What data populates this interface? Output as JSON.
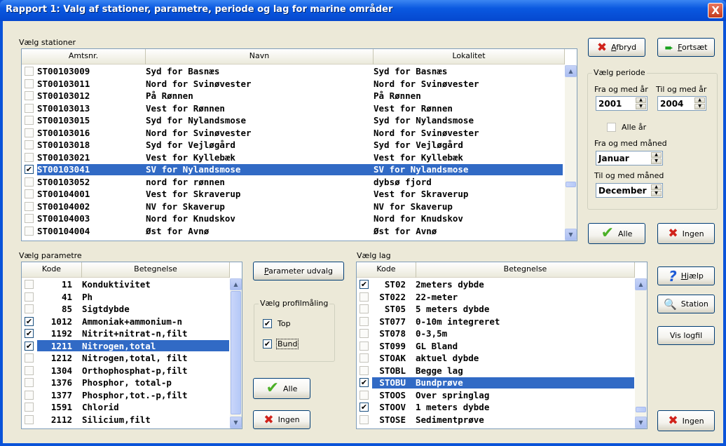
{
  "window": {
    "title": "Rapport 1: Valg af stationer, parametre, periode og lag for marine områder",
    "close_glyph": "X"
  },
  "stations": {
    "group_label": "Vælg stationer",
    "columns": [
      "Amtsnr.",
      "Navn",
      "Lokalitet"
    ],
    "rows": [
      {
        "checked": false,
        "selected": false,
        "amtsnr": "ST00103009",
        "navn": "Syd for Basnæs",
        "lokalitet": "Syd for Basnæs"
      },
      {
        "checked": false,
        "selected": false,
        "amtsnr": "ST00103011",
        "navn": "Nord for Svinøvester",
        "lokalitet": "Nord for Svinøvester"
      },
      {
        "checked": false,
        "selected": false,
        "amtsnr": "ST00103012",
        "navn": "På Rønnen",
        "lokalitet": "På Rønnen"
      },
      {
        "checked": false,
        "selected": false,
        "amtsnr": "ST00103013",
        "navn": "Vest for Rønnen",
        "lokalitet": "Vest for Rønnen"
      },
      {
        "checked": false,
        "selected": false,
        "amtsnr": "ST00103015",
        "navn": "Syd for Nylandsmose",
        "lokalitet": "Syd for Nylandsmose"
      },
      {
        "checked": false,
        "selected": false,
        "amtsnr": "ST00103016",
        "navn": "Nord for Svinøvester",
        "lokalitet": "Nord for Svinøvester"
      },
      {
        "checked": false,
        "selected": false,
        "amtsnr": "ST00103018",
        "navn": "Syd for Vejløgård",
        "lokalitet": "Syd for Vejløgård"
      },
      {
        "checked": false,
        "selected": false,
        "amtsnr": "ST00103021",
        "navn": "Vest for Kyllebæk",
        "lokalitet": "Vest for Kyllebæk"
      },
      {
        "checked": true,
        "selected": true,
        "amtsnr": "ST00103041",
        "navn": "SV for Nylandsmose",
        "lokalitet": "SV for Nylandsmose"
      },
      {
        "checked": false,
        "selected": false,
        "amtsnr": "ST00103052",
        "navn": "nord for rønnen",
        "lokalitet": "dybsø fjord"
      },
      {
        "checked": false,
        "selected": false,
        "amtsnr": "ST00104001",
        "navn": "Vest for Skraverup",
        "lokalitet": "Vest for Skraverup"
      },
      {
        "checked": false,
        "selected": false,
        "amtsnr": "ST00104002",
        "navn": "NV for Skaverup",
        "lokalitet": "NV for Skaverup"
      },
      {
        "checked": false,
        "selected": false,
        "amtsnr": "ST00104003",
        "navn": "Nord for Knudskov",
        "lokalitet": "Nord for Knudskov"
      },
      {
        "checked": false,
        "selected": false,
        "amtsnr": "ST00104004",
        "navn": "Øst for Avnø",
        "lokalitet": "Øst for Avnø"
      }
    ]
  },
  "parameters": {
    "group_label": "Vælg parametre",
    "columns": [
      "Kode",
      "Betegnelse"
    ],
    "rows": [
      {
        "checked": false,
        "selected": false,
        "kode": "11",
        "betegnelse": "Konduktivitet"
      },
      {
        "checked": false,
        "selected": false,
        "kode": "41",
        "betegnelse": "Ph"
      },
      {
        "checked": false,
        "selected": false,
        "kode": "85",
        "betegnelse": "Sigtdybde"
      },
      {
        "checked": true,
        "selected": false,
        "kode": "1012",
        "betegnelse": "Ammoniak+ammonium-n"
      },
      {
        "checked": true,
        "selected": false,
        "kode": "1192",
        "betegnelse": "Nitrit+nitrat-n,filt"
      },
      {
        "checked": true,
        "selected": true,
        "kode": "1211",
        "betegnelse": "Nitrogen,total"
      },
      {
        "checked": false,
        "selected": false,
        "kode": "1212",
        "betegnelse": "Nitrogen,total, filt"
      },
      {
        "checked": false,
        "selected": false,
        "kode": "1304",
        "betegnelse": "Orthophosphat-p,filt"
      },
      {
        "checked": false,
        "selected": false,
        "kode": "1376",
        "betegnelse": "Phosphor, total-p"
      },
      {
        "checked": false,
        "selected": false,
        "kode": "1377",
        "betegnelse": "Phosphor,tot.-p,filt"
      },
      {
        "checked": false,
        "selected": false,
        "kode": "1591",
        "betegnelse": "Chlorid"
      },
      {
        "checked": false,
        "selected": false,
        "kode": "2112",
        "betegnelse": "Silicium,filt"
      }
    ]
  },
  "layers": {
    "group_label": "Vælg lag",
    "columns": [
      "Kode",
      "Betegnelse"
    ],
    "rows": [
      {
        "checked": true,
        "selected": false,
        "kode": "ST02",
        "betegnelse": "2meters dybde"
      },
      {
        "checked": false,
        "selected": false,
        "kode": "ST022",
        "betegnelse": "22-meter"
      },
      {
        "checked": false,
        "selected": false,
        "kode": "ST05",
        "betegnelse": "5 meters dybde"
      },
      {
        "checked": false,
        "selected": false,
        "kode": "ST077",
        "betegnelse": "0-10m integreret"
      },
      {
        "checked": false,
        "selected": false,
        "kode": "ST078",
        "betegnelse": "0-3,5m"
      },
      {
        "checked": false,
        "selected": false,
        "kode": "ST099",
        "betegnelse": "GL Bland"
      },
      {
        "checked": false,
        "selected": false,
        "kode": "STOAK",
        "betegnelse": "aktuel dybde"
      },
      {
        "checked": false,
        "selected": false,
        "kode": "STOBL",
        "betegnelse": "Begge lag"
      },
      {
        "checked": true,
        "selected": true,
        "kode": "STOBU",
        "betegnelse": "Bundprøve"
      },
      {
        "checked": false,
        "selected": false,
        "kode": "STOOS",
        "betegnelse": "Over springlag"
      },
      {
        "checked": true,
        "selected": false,
        "kode": "STOOV",
        "betegnelse": "1 meters dybde"
      },
      {
        "checked": false,
        "selected": false,
        "kode": "STOSE",
        "betegnelse": "Sedimentprøve"
      }
    ]
  },
  "buttons": {
    "afbryd_u": "A",
    "afbryd_rest": "fbryd",
    "fortsaet_u": "F",
    "fortsaet_rest": "ortsæt",
    "alle": "Alle",
    "ingen": "Ingen",
    "parameter_udvalg_u": "P",
    "parameter_udvalg_rest": "arameter udvalg",
    "hjaelp_u": "H",
    "hjaelp_rest": "jælp",
    "station": "Station",
    "vis_logfil": "Vis logfil"
  },
  "periode": {
    "group_label": "Vælg periode",
    "fra_aar_label": "Fra og med år",
    "til_aar_label": "Til og med år",
    "fra_aar": "2001",
    "til_aar": "2004",
    "alle_aar_label": "Alle år",
    "alle_aar_checked": false,
    "fra_maaned_label": "Fra og med måned",
    "fra_maaned": "Januar",
    "til_maaned_label": "Til og med måned",
    "til_maaned": "December"
  },
  "profil": {
    "group_label": "Vælg profilmåling",
    "top_label": "Top",
    "top_checked": true,
    "bund_label": "Bund",
    "bund_checked": true
  },
  "colors": {
    "title_bar": "#0a58e0",
    "selection": "#316ac5",
    "dialog_bg": "#ece9d8",
    "cancel_red": "#d0221b",
    "ok_green": "#4bb026"
  },
  "icons": {
    "check": "✔",
    "x": "✖",
    "arrow": "➨",
    "question": "?",
    "magnifier": "🔍",
    "up": "▲",
    "down": "▼"
  }
}
